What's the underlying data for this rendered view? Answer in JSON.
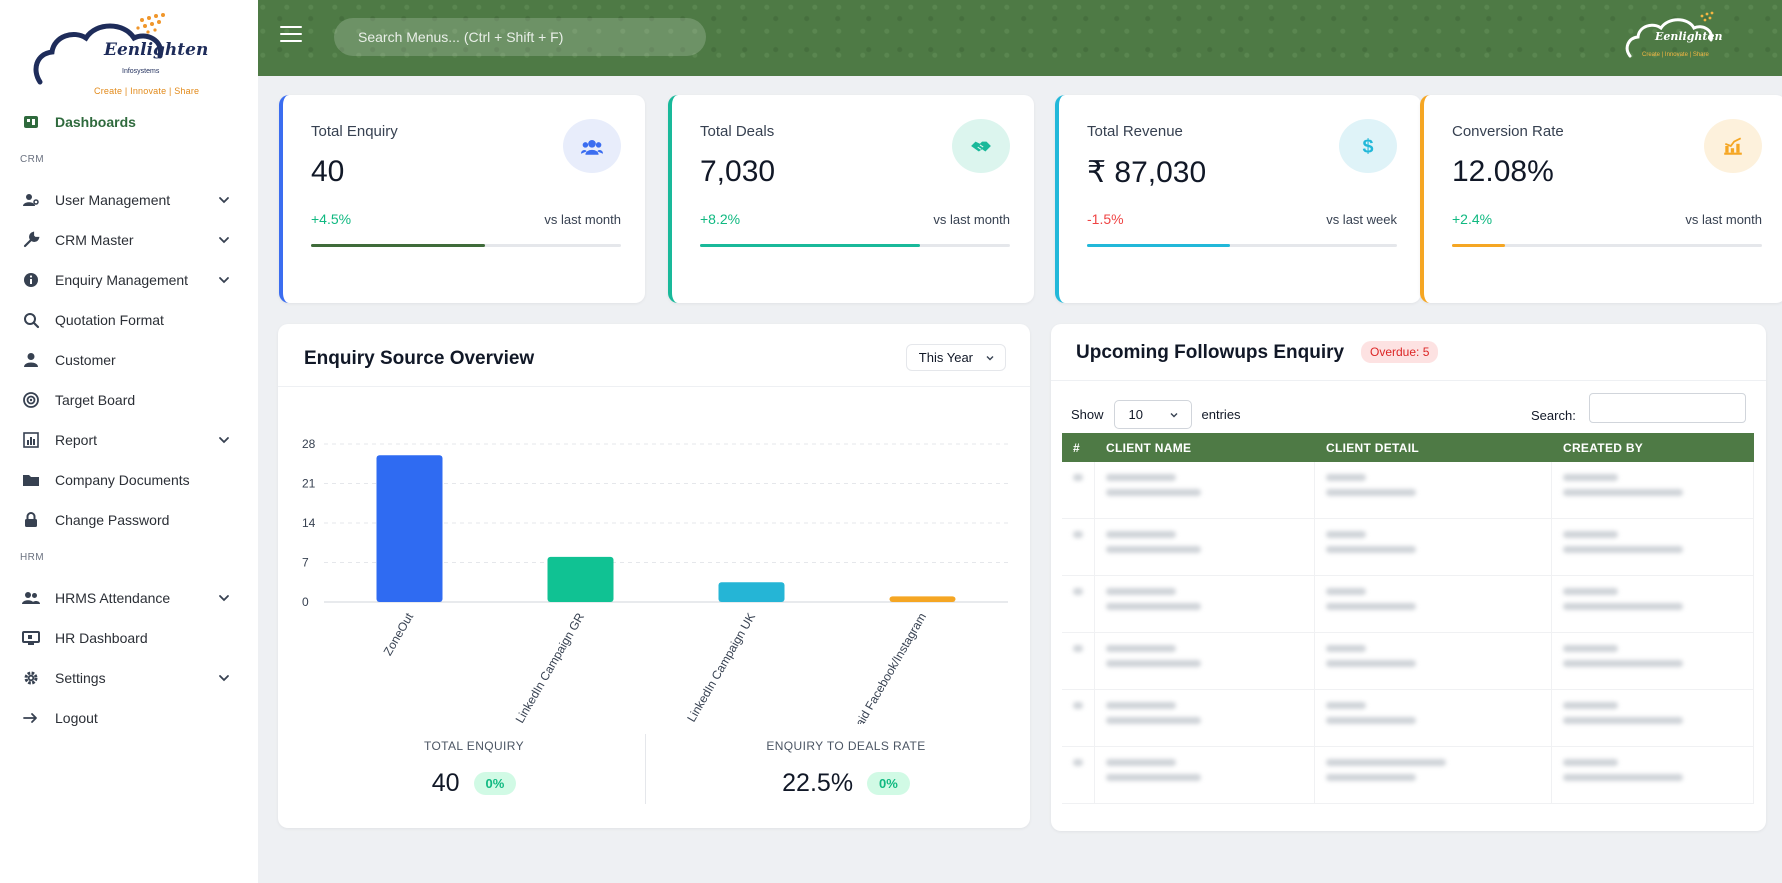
{
  "brand": {
    "name": "Eenlighten",
    "sub": "Infosystems",
    "tagline": "Create | Innovate | Share"
  },
  "header": {
    "search_placeholder": "Search Menus... (Ctrl + Shift + F)"
  },
  "sidebar": {
    "items": [
      {
        "label": "Dashboards",
        "icon": "dashboard-icon",
        "active": true
      },
      {
        "section": "CRM"
      },
      {
        "label": "User Management",
        "icon": "user-cog-icon",
        "has_submenu": true
      },
      {
        "label": "CRM Master",
        "icon": "wrench-icon",
        "has_submenu": true
      },
      {
        "label": "Enquiry Management",
        "icon": "info-icon",
        "has_submenu": true
      },
      {
        "label": "Quotation Format",
        "icon": "search-icon"
      },
      {
        "label": "Customer",
        "icon": "user-icon"
      },
      {
        "label": "Target Board",
        "icon": "target-icon"
      },
      {
        "label": "Report",
        "icon": "bar-chart-icon",
        "has_submenu": true
      },
      {
        "label": "Company Documents",
        "icon": "folder-icon"
      },
      {
        "label": "Change Password",
        "icon": "lock-icon"
      },
      {
        "section": "HRM"
      },
      {
        "label": "HRMS Attendance",
        "icon": "users-icon",
        "has_submenu": true
      },
      {
        "label": "HR Dashboard",
        "icon": "monitor-icon"
      },
      {
        "label": "Settings",
        "icon": "gear-icon",
        "has_submenu": true
      },
      {
        "label": "Logout",
        "icon": "logout-icon"
      }
    ]
  },
  "stats": [
    {
      "label": "Total Enquiry",
      "value": "40",
      "change": "+4.5%",
      "compare": "vs last month",
      "progress": 0.56,
      "accent": "#3b6df0",
      "bar": "#3f6b3a",
      "change_color": "#10b981",
      "icon": "users-icon",
      "icon_bg": "#e8edfb"
    },
    {
      "label": "Total Deals",
      "value": "7,030",
      "change": "+8.2%",
      "compare": "vs last month",
      "progress": 0.71,
      "accent": "#19b99a",
      "bar": "#19b99a",
      "change_color": "#10b981",
      "icon": "handshake-icon",
      "icon_bg": "#dcf5ee"
    },
    {
      "label": "Total Revenue",
      "value": "₹ 87,030",
      "change": "-1.5%",
      "compare": "vs last week",
      "progress": 0.46,
      "accent": "#22b8d9",
      "bar": "#22b8d9",
      "change_color": "#ef4444",
      "icon": "dollar-icon",
      "icon_bg": "#dff3f8"
    },
    {
      "label": "Conversion Rate",
      "value": "12.08%",
      "change": "+2.4%",
      "compare": "vs last month",
      "progress": 0.17,
      "accent": "#f5a623",
      "bar": "#f5a623",
      "change_color": "#10b981",
      "icon": "chart-up-icon",
      "icon_bg": "#fdf1dc"
    }
  ],
  "overview": {
    "title": "Enquiry Source Overview",
    "period": "This Year",
    "total_label": "TOTAL ENQUIRY",
    "total_value": "40",
    "total_change": "0%",
    "rate_label": "ENQUIRY TO DEALS RATE",
    "rate_value": "22.5%",
    "rate_change": "0%"
  },
  "chart_data": {
    "type": "bar",
    "categories": [
      "ZoneOut",
      "LinkedIn Campaign GR",
      "LinkedIn Campaign UK",
      "Junaid Facebook/Instagram"
    ],
    "values": [
      26,
      8,
      3.5,
      1
    ],
    "colors": [
      "#2f6bf2",
      "#10c293",
      "#25b5d6",
      "#f5a623"
    ],
    "yticks": [
      0,
      7,
      14,
      21,
      28
    ],
    "ylim": [
      0,
      28
    ],
    "grid": true
  },
  "followups": {
    "title": "Upcoming Followups Enquiry",
    "overdue": "Overdue: 5",
    "show_label": "Show",
    "page_length": "10",
    "entries_label": "entries",
    "search_label": "Search:",
    "columns": [
      "#",
      "CLIENT NAME",
      "CLIENT DETAIL",
      "CREATED BY"
    ]
  }
}
